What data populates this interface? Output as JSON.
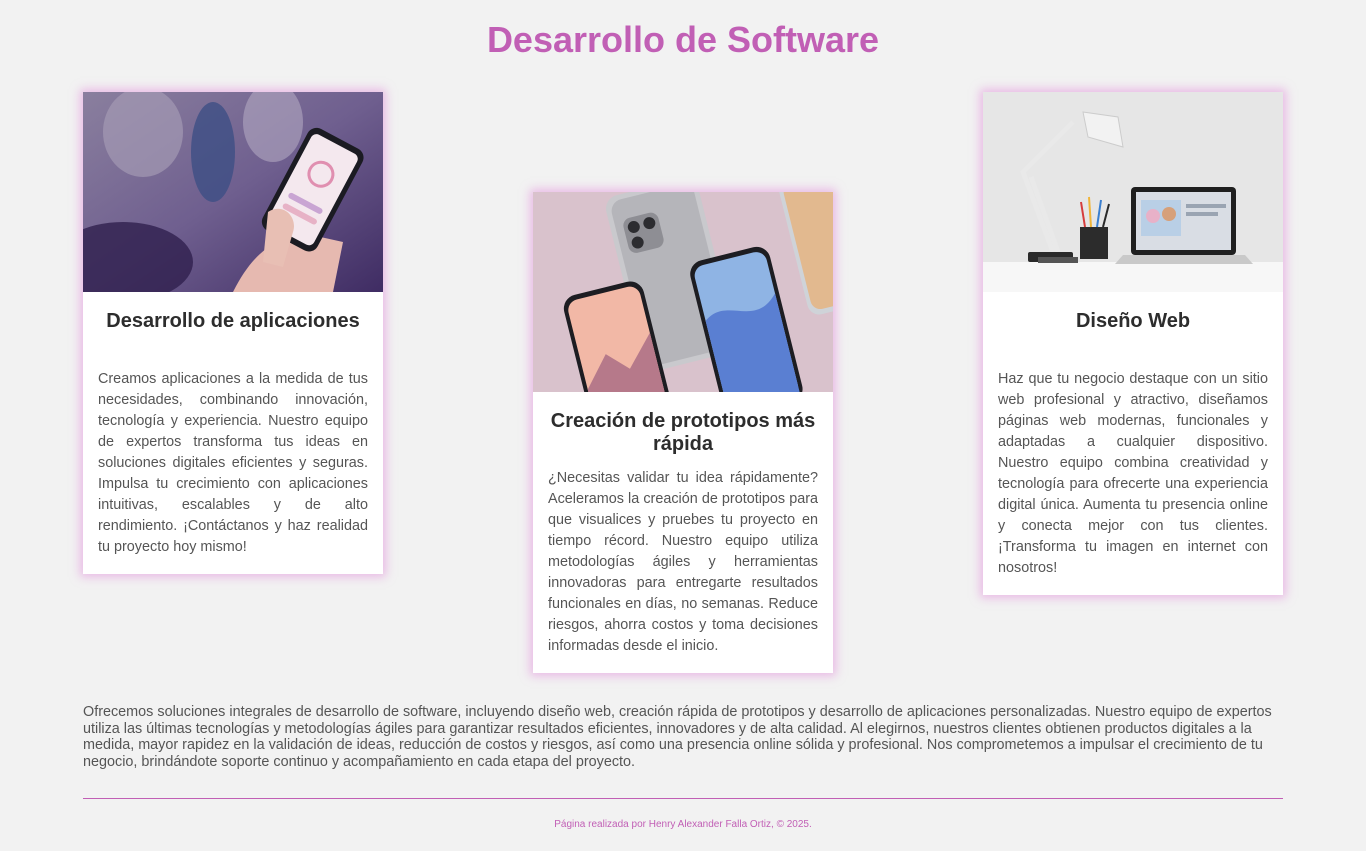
{
  "page": {
    "title": "Desarrollo de Software",
    "accent_color": "#c15fb5",
    "background_color": "#f2f2f2"
  },
  "cards": [
    {
      "id": "apps",
      "image_icon": "phone-in-hand-photo",
      "title": "Desarrollo de aplicaciones",
      "text": "Creamos aplicaciones a la medida de tus necesidades, combinando innovación, tecnología y experiencia. Nuestro equipo de expertos transforma tus ideas en soluciones digitales eficientes y seguras. Impulsa tu crecimiento con aplicaciones intuitivas, escalables y de alto rendimiento. ¡Contáctanos y haz realidad tu proyecto hoy mismo!"
    },
    {
      "id": "proto",
      "image_icon": "smartphones-mockup-photo",
      "title": "Creación de prototipos más rápida",
      "text": "¿Necesitas validar tu idea rápidamente? Aceleramos la creación de prototipos para que visualices y pruebes tu proyecto en tiempo récord. Nuestro equipo utiliza metodologías ágiles y herramientas innovadoras para entregarte resultados funcionales en días, no semanas. Reduce riesgos, ahorra costos y toma decisiones informadas desde el inicio."
    },
    {
      "id": "web",
      "image_icon": "desk-laptop-lamp-photo",
      "title": "Diseño Web",
      "text": "Haz que tu negocio destaque con un sitio web profesional y atractivo, diseñamos páginas web modernas, funcionales y adaptadas a cualquier dispositivo. Nuestro equipo combina creatividad y tecnología para ofrecerte una experiencia digital única. Aumenta tu presencia online y conecta mejor con tus clientes. ¡Transforma tu imagen en internet con nosotros!"
    }
  ],
  "summary": "Ofrecemos soluciones integrales de desarrollo de software, incluyendo diseño web, creación rápida de prototipos y desarrollo de aplicaciones personalizadas. Nuestro equipo de expertos utiliza las últimas tecnologías y metodologías ágiles para garantizar resultados eficientes, innovadores y de alta calidad. Al elegirnos, nuestros clientes obtienen productos digitales a la medida, mayor rapidez en la validación de ideas, reducción de costos y riesgos, así como una presencia online sólida y profesional. Nos comprometemos a impulsar el crecimiento de tu negocio, brindándote soporte continuo y acompañamiento en cada etapa del proyecto.",
  "footer": {
    "text": "Página realizada por Henry Alexander Falla Ortiz, © 2025."
  }
}
